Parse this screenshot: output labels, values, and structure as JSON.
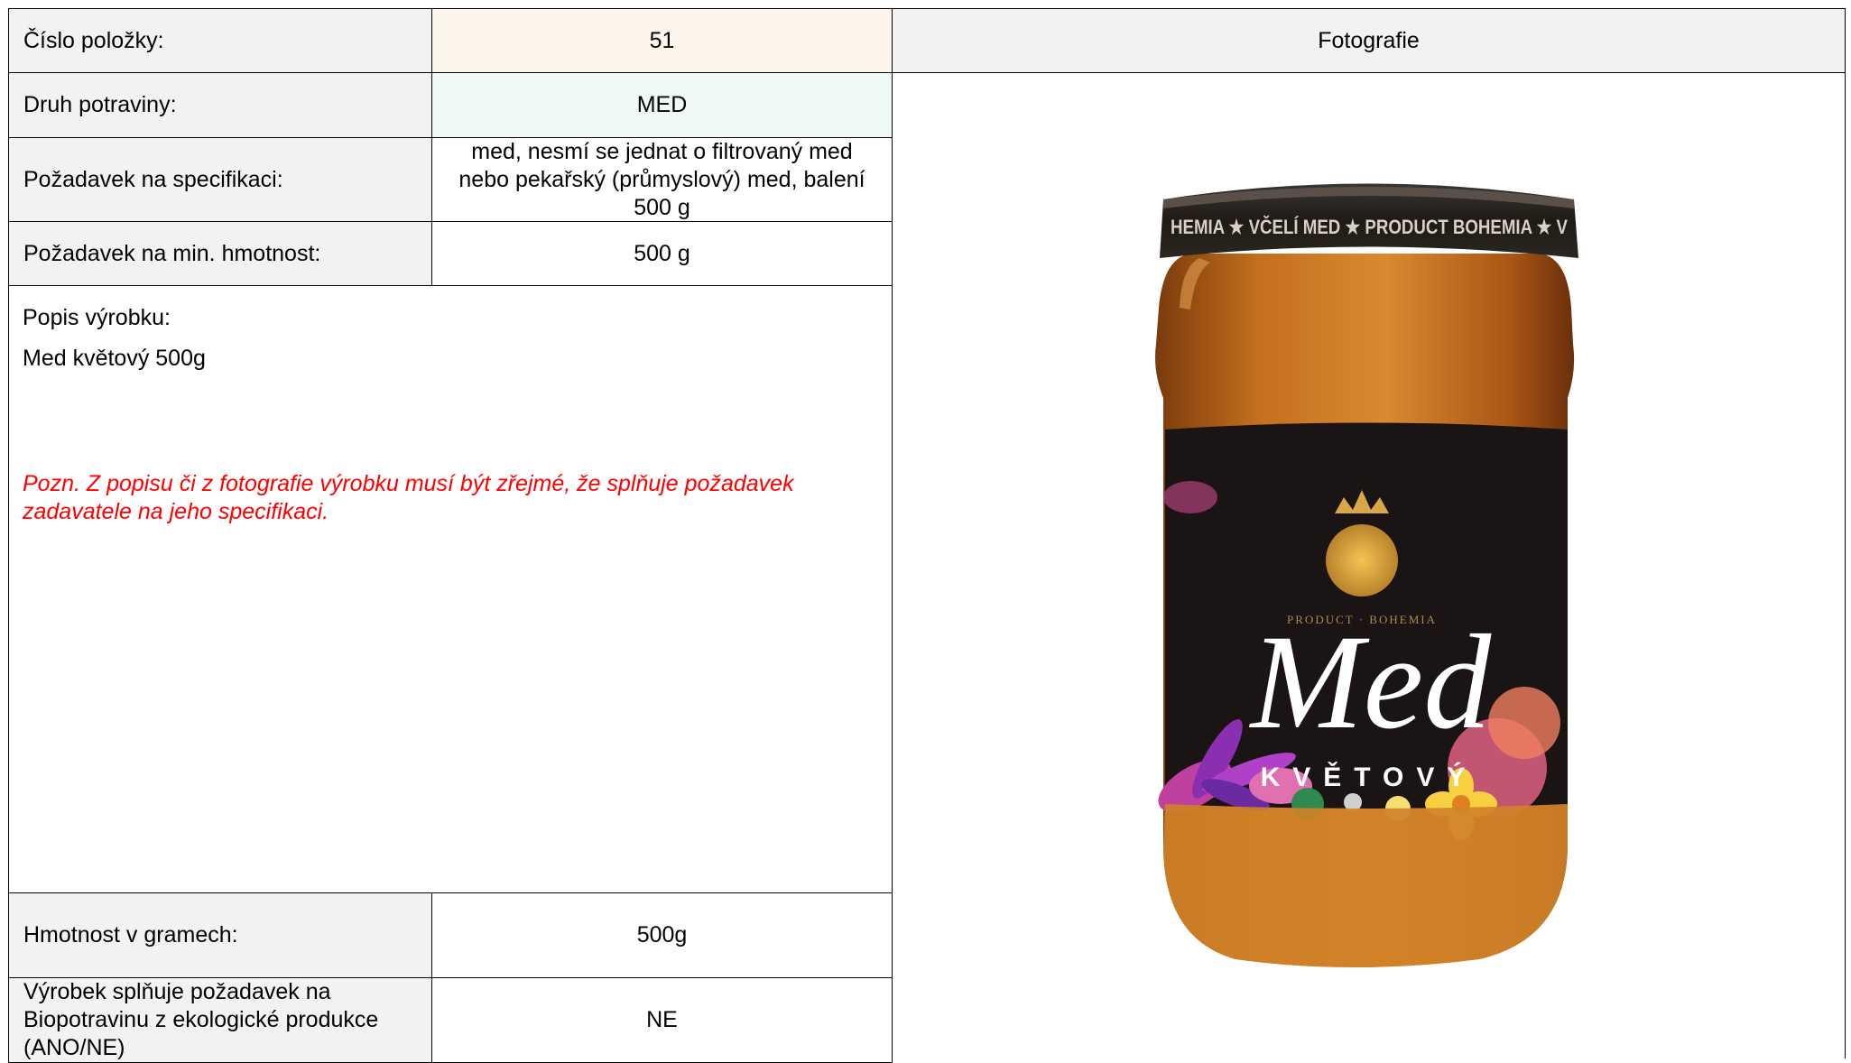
{
  "table": {
    "item_number_label": "Číslo položky:",
    "item_number_value": "51",
    "photo_header": "Fotografie",
    "food_type_label": "Druh potraviny:",
    "food_type_value": "MED",
    "spec_label": "Požadavek na specifikaci:",
    "spec_value_lines": [
      "med, nesmí se jednat o filtrovaný med",
      "nebo pekařský (průmyslový) med, balení",
      "500 g"
    ],
    "min_weight_label": "Požadavek na min. hmotnost:",
    "min_weight_value": "500 g",
    "description_label": "Popis výrobku:",
    "description_value": "Med květový 500g",
    "note_text": "Pozn. Z popisu či z fotografie výrobku musí být zřejmé, že splňuje požadavek zadavatele na jeho specifikaci.",
    "weight_grams_label": "Hmotnost v gramech:",
    "weight_grams_value": "500g",
    "bio_label_lines": [
      "Výrobek splňuje požadavek na",
      "Biopotravinu z ekologické produkce",
      "(ANO/NE)"
    ],
    "bio_value": "NE"
  },
  "photo": {
    "lid_text": "HEMIA ★ VČELÍ MED ★ PRODUCT BOHEMIA ★ V",
    "label_title": "Med",
    "label_subtitle": "KVĚTOVÝ",
    "emblem_text": "PRODUCT · BOHEMIA"
  },
  "colors": {
    "note_red": "#ff0000",
    "label_bg": "#f2f2f2",
    "item_value_bg": "#fdf4ec",
    "food_value_bg": "#eefaf3",
    "honey": "#c06a1c",
    "jar_label": "#1a1414"
  }
}
